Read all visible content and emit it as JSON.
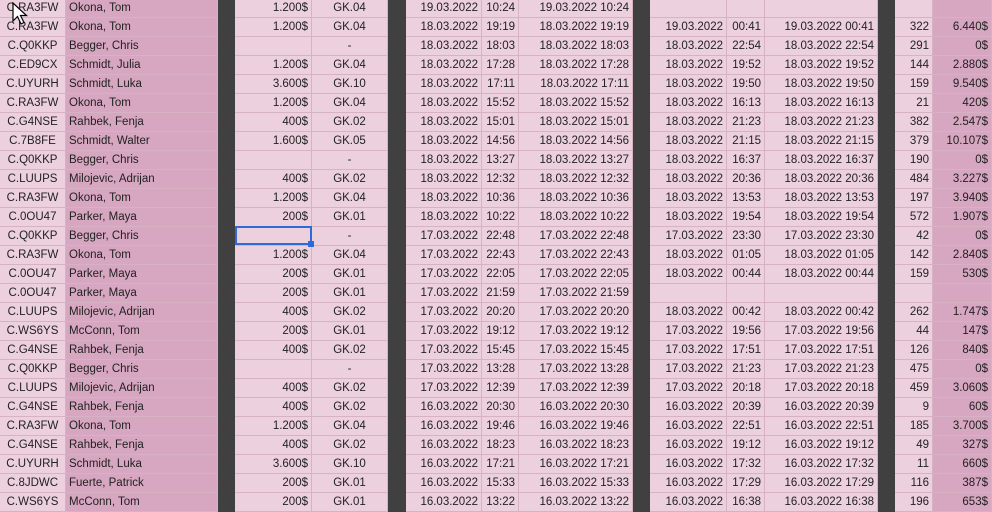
{
  "rows": [
    {
      "code": "C.RA3FW",
      "name": "Okona, Tom",
      "price": "1.200$",
      "tier": "GK.04",
      "d1": "19.03.2022",
      "t1": "10:24",
      "dt1": "19.03.2022 10:24",
      "d2": "",
      "t2": "",
      "dt2": "",
      "n": "",
      "amt": ""
    },
    {
      "code": "C.RA3FW",
      "name": "Okona, Tom",
      "price": "1.200$",
      "tier": "GK.04",
      "d1": "18.03.2022",
      "t1": "19:19",
      "dt1": "18.03.2022 19:19",
      "d2": "19.03.2022",
      "t2": "00:41",
      "dt2": "19.03.2022 00:41",
      "n": "322",
      "amt": "6.440$"
    },
    {
      "code": "C.Q0KKP",
      "name": "Begger, Chris",
      "price": "",
      "tier": "-",
      "d1": "18.03.2022",
      "t1": "18:03",
      "dt1": "18.03.2022 18:03",
      "d2": "18.03.2022",
      "t2": "22:54",
      "dt2": "18.03.2022 22:54",
      "n": "291",
      "amt": "0$"
    },
    {
      "code": "C.ED9CX",
      "name": "Schmidt, Julia",
      "price": "1.200$",
      "tier": "GK.04",
      "d1": "18.03.2022",
      "t1": "17:28",
      "dt1": "18.03.2022 17:28",
      "d2": "18.03.2022",
      "t2": "19:52",
      "dt2": "18.03.2022 19:52",
      "n": "144",
      "amt": "2.880$"
    },
    {
      "code": "C.UYURH",
      "name": "Schmidt, Luka",
      "price": "3.600$",
      "tier": "GK.10",
      "d1": "18.03.2022",
      "t1": "17:11",
      "dt1": "18.03.2022 17:11",
      "d2": "18.03.2022",
      "t2": "19:50",
      "dt2": "18.03.2022 19:50",
      "n": "159",
      "amt": "9.540$"
    },
    {
      "code": "C.RA3FW",
      "name": "Okona, Tom",
      "price": "1.200$",
      "tier": "GK.04",
      "d1": "18.03.2022",
      "t1": "15:52",
      "dt1": "18.03.2022 15:52",
      "d2": "18.03.2022",
      "t2": "16:13",
      "dt2": "18.03.2022 16:13",
      "n": "21",
      "amt": "420$"
    },
    {
      "code": "C.G4NSE",
      "name": "Rahbek, Fenja",
      "price": "400$",
      "tier": "GK.02",
      "d1": "18.03.2022",
      "t1": "15:01",
      "dt1": "18.03.2022 15:01",
      "d2": "18.03.2022",
      "t2": "21:23",
      "dt2": "18.03.2022 21:23",
      "n": "382",
      "amt": "2.547$"
    },
    {
      "code": "C.7B8FE",
      "name": "Schmidt, Walter",
      "price": "1.600$",
      "tier": "GK.05",
      "d1": "18.03.2022",
      "t1": "14:56",
      "dt1": "18.03.2022 14:56",
      "d2": "18.03.2022",
      "t2": "21:15",
      "dt2": "18.03.2022 21:15",
      "n": "379",
      "amt": "10.107$"
    },
    {
      "code": "C.Q0KKP",
      "name": "Begger, Chris",
      "price": "",
      "tier": "-",
      "d1": "18.03.2022",
      "t1": "13:27",
      "dt1": "18.03.2022 13:27",
      "d2": "18.03.2022",
      "t2": "16:37",
      "dt2": "18.03.2022 16:37",
      "n": "190",
      "amt": "0$"
    },
    {
      "code": "C.LUUPS",
      "name": "Milojevic, Adrijan",
      "price": "400$",
      "tier": "GK.02",
      "d1": "18.03.2022",
      "t1": "12:32",
      "dt1": "18.03.2022 12:32",
      "d2": "18.03.2022",
      "t2": "20:36",
      "dt2": "18.03.2022 20:36",
      "n": "484",
      "amt": "3.227$"
    },
    {
      "code": "C.RA3FW",
      "name": "Okona, Tom",
      "price": "1.200$",
      "tier": "GK.04",
      "d1": "18.03.2022",
      "t1": "10:36",
      "dt1": "18.03.2022 10:36",
      "d2": "18.03.2022",
      "t2": "13:53",
      "dt2": "18.03.2022 13:53",
      "n": "197",
      "amt": "3.940$"
    },
    {
      "code": "C.0OU47",
      "name": "Parker, Maya",
      "price": "200$",
      "tier": "GK.01",
      "d1": "18.03.2022",
      "t1": "10:22",
      "dt1": "18.03.2022 10:22",
      "d2": "18.03.2022",
      "t2": "19:54",
      "dt2": "18.03.2022 19:54",
      "n": "572",
      "amt": "1.907$"
    },
    {
      "code": "C.Q0KKP",
      "name": "Begger, Chris",
      "price": "",
      "tier": "-",
      "d1": "17.03.2022",
      "t1": "22:48",
      "dt1": "17.03.2022 22:48",
      "d2": "17.03.2022",
      "t2": "23:30",
      "dt2": "17.03.2022 23:30",
      "n": "42",
      "amt": "0$"
    },
    {
      "code": "C.RA3FW",
      "name": "Okona, Tom",
      "price": "1.200$",
      "tier": "GK.04",
      "d1": "17.03.2022",
      "t1": "22:43",
      "dt1": "17.03.2022 22:43",
      "d2": "18.03.2022",
      "t2": "01:05",
      "dt2": "18.03.2022 01:05",
      "n": "142",
      "amt": "2.840$"
    },
    {
      "code": "C.0OU47",
      "name": "Parker, Maya",
      "price": "200$",
      "tier": "GK.01",
      "d1": "17.03.2022",
      "t1": "22:05",
      "dt1": "17.03.2022 22:05",
      "d2": "18.03.2022",
      "t2": "00:44",
      "dt2": "18.03.2022 00:44",
      "n": "159",
      "amt": "530$"
    },
    {
      "code": "C.0OU47",
      "name": "Parker, Maya",
      "price": "200$",
      "tier": "GK.01",
      "d1": "17.03.2022",
      "t1": "21:59",
      "dt1": "17.03.2022 21:59",
      "d2": "",
      "t2": "",
      "dt2": "",
      "n": "",
      "amt": ""
    },
    {
      "code": "C.LUUPS",
      "name": "Milojevic, Adrijan",
      "price": "400$",
      "tier": "GK.02",
      "d1": "17.03.2022",
      "t1": "20:20",
      "dt1": "17.03.2022 20:20",
      "d2": "18.03.2022",
      "t2": "00:42",
      "dt2": "18.03.2022 00:42",
      "n": "262",
      "amt": "1.747$"
    },
    {
      "code": "C.WS6YS",
      "name": "McConn, Tom",
      "price": "200$",
      "tier": "GK.01",
      "d1": "17.03.2022",
      "t1": "19:12",
      "dt1": "17.03.2022 19:12",
      "d2": "17.03.2022",
      "t2": "19:56",
      "dt2": "17.03.2022 19:56",
      "n": "44",
      "amt": "147$"
    },
    {
      "code": "C.G4NSE",
      "name": "Rahbek, Fenja",
      "price": "400$",
      "tier": "GK.02",
      "d1": "17.03.2022",
      "t1": "15:45",
      "dt1": "17.03.2022 15:45",
      "d2": "17.03.2022",
      "t2": "17:51",
      "dt2": "17.03.2022 17:51",
      "n": "126",
      "amt": "840$"
    },
    {
      "code": "C.Q0KKP",
      "name": "Begger, Chris",
      "price": "",
      "tier": "-",
      "d1": "17.03.2022",
      "t1": "13:28",
      "dt1": "17.03.2022 13:28",
      "d2": "17.03.2022",
      "t2": "21:23",
      "dt2": "17.03.2022 21:23",
      "n": "475",
      "amt": "0$"
    },
    {
      "code": "C.LUUPS",
      "name": "Milojevic, Adrijan",
      "price": "400$",
      "tier": "GK.02",
      "d1": "17.03.2022",
      "t1": "12:39",
      "dt1": "17.03.2022 12:39",
      "d2": "17.03.2022",
      "t2": "20:18",
      "dt2": "17.03.2022 20:18",
      "n": "459",
      "amt": "3.060$"
    },
    {
      "code": "C.G4NSE",
      "name": "Rahbek, Fenja",
      "price": "400$",
      "tier": "GK.02",
      "d1": "16.03.2022",
      "t1": "20:30",
      "dt1": "16.03.2022 20:30",
      "d2": "16.03.2022",
      "t2": "20:39",
      "dt2": "16.03.2022 20:39",
      "n": "9",
      "amt": "60$"
    },
    {
      "code": "C.RA3FW",
      "name": "Okona, Tom",
      "price": "1.200$",
      "tier": "GK.04",
      "d1": "16.03.2022",
      "t1": "19:46",
      "dt1": "16.03.2022 19:46",
      "d2": "16.03.2022",
      "t2": "22:51",
      "dt2": "16.03.2022 22:51",
      "n": "185",
      "amt": "3.700$"
    },
    {
      "code": "C.G4NSE",
      "name": "Rahbek, Fenja",
      "price": "400$",
      "tier": "GK.02",
      "d1": "16.03.2022",
      "t1": "18:23",
      "dt1": "16.03.2022 18:23",
      "d2": "16.03.2022",
      "t2": "19:12",
      "dt2": "16.03.2022 19:12",
      "n": "49",
      "amt": "327$"
    },
    {
      "code": "C.UYURH",
      "name": "Schmidt, Luka",
      "price": "3.600$",
      "tier": "GK.10",
      "d1": "16.03.2022",
      "t1": "17:21",
      "dt1": "16.03.2022 17:21",
      "d2": "16.03.2022",
      "t2": "17:32",
      "dt2": "16.03.2022 17:32",
      "n": "11",
      "amt": "660$"
    },
    {
      "code": "C.8JDWC",
      "name": "Fuerte, Patrick",
      "price": "200$",
      "tier": "GK.01",
      "d1": "16.03.2022",
      "t1": "15:33",
      "dt1": "16.03.2022 15:33",
      "d2": "16.03.2022",
      "t2": "17:29",
      "dt2": "16.03.2022 17:29",
      "n": "116",
      "amt": "387$"
    },
    {
      "code": "C.WS6YS",
      "name": "McConn, Tom",
      "price": "200$",
      "tier": "GK.01",
      "d1": "16.03.2022",
      "t1": "13:22",
      "dt1": "16.03.2022 13:22",
      "d2": "16.03.2022",
      "t2": "16:38",
      "dt2": "16.03.2022 16:38",
      "n": "196",
      "amt": "653$"
    }
  ]
}
